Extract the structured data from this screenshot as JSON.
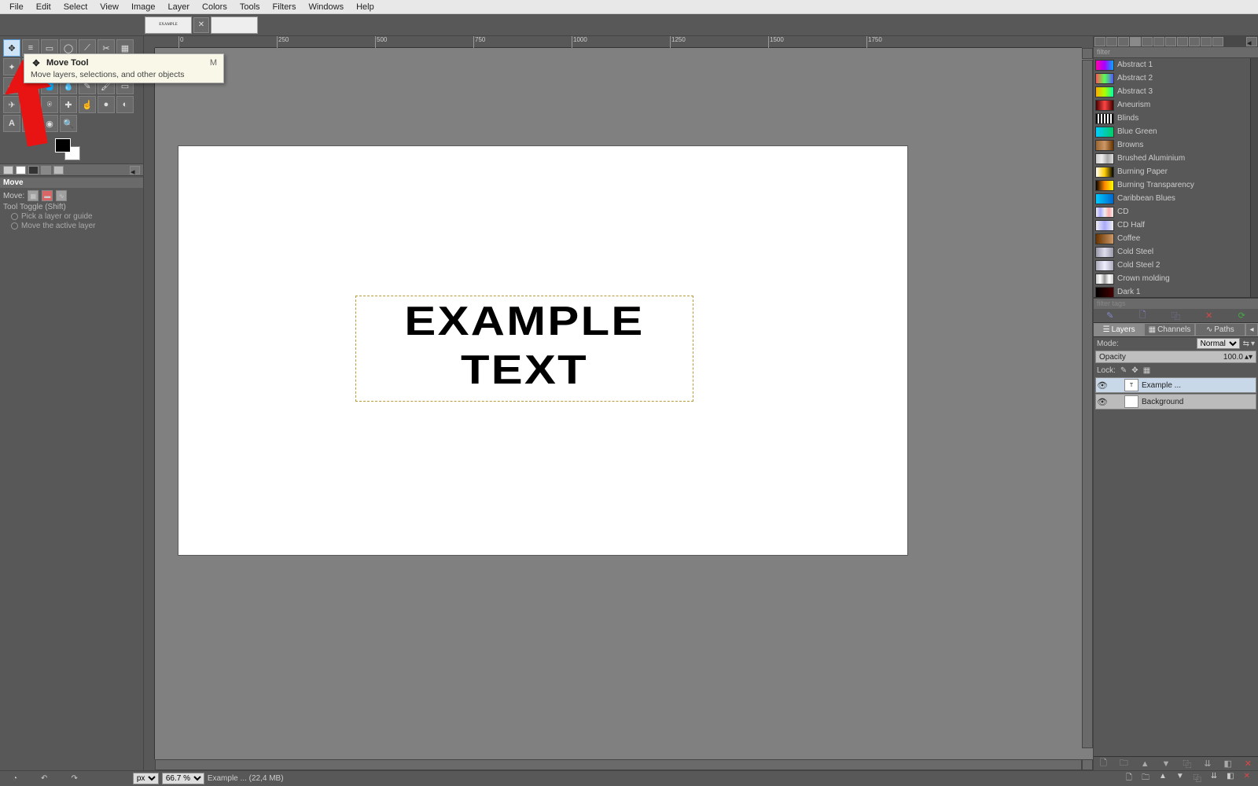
{
  "menubar": [
    "File",
    "Edit",
    "Select",
    "View",
    "Image",
    "Layer",
    "Colors",
    "Tools",
    "Filters",
    "Windows",
    "Help"
  ],
  "tooltip": {
    "title": "Move Tool",
    "shortcut": "M",
    "desc": "Move layers, selections, and other objects"
  },
  "tool_options": {
    "title": "Move",
    "move_label": "Move:",
    "toggle_label": "Tool Toggle  (Shift)",
    "radio1": "Pick a layer or guide",
    "radio2": "Move the active layer"
  },
  "ruler_ticks": [
    "0",
    "250",
    "500",
    "750",
    "1000",
    "1250",
    "1500",
    "1750"
  ],
  "canvas_text": {
    "line1": "EXAMPLE",
    "line2": "TEXT"
  },
  "gradients": [
    {
      "name": "Abstract 1",
      "css": "linear-gradient(90deg,#f0a,#a0f,#0af)"
    },
    {
      "name": "Abstract 2",
      "css": "linear-gradient(90deg,#f55,#5f5,#55f)"
    },
    {
      "name": "Abstract 3",
      "css": "linear-gradient(90deg,#fa0,#af0,#0fa)"
    },
    {
      "name": "Aneurism",
      "css": "linear-gradient(90deg,#400,#f44,#400)"
    },
    {
      "name": "Blinds",
      "css": "repeating-linear-gradient(90deg,#000 0 2px,#fff 2px 4px)"
    },
    {
      "name": "Blue Green",
      "css": "linear-gradient(90deg,#0cf,#0c6)"
    },
    {
      "name": "Browns",
      "css": "linear-gradient(90deg,#963,#c96,#630)"
    },
    {
      "name": "Brushed Aluminium",
      "css": "linear-gradient(90deg,#ccc,#eee,#aaa,#ddd)"
    },
    {
      "name": "Burning Paper",
      "css": "linear-gradient(90deg,#fff,#fc0,#000)"
    },
    {
      "name": "Burning Transparency",
      "css": "linear-gradient(90deg,#000,#f80,#ff0)"
    },
    {
      "name": "Caribbean Blues",
      "css": "linear-gradient(90deg,#0cf,#06c)"
    },
    {
      "name": "CD",
      "css": "linear-gradient(90deg,#eee,#aaf,#eee,#faa,#eee)"
    },
    {
      "name": "CD Half",
      "css": "linear-gradient(90deg,#eee,#aaf,#eee)"
    },
    {
      "name": "Coffee",
      "css": "linear-gradient(90deg,#630,#c96)"
    },
    {
      "name": "Cold Steel",
      "css": "linear-gradient(90deg,#99a,#dde,#99a)"
    },
    {
      "name": "Cold Steel 2",
      "css": "linear-gradient(90deg,#aab,#eef,#aab)"
    },
    {
      "name": "Crown molding",
      "css": "linear-gradient(90deg,#ccc,#fff,#999,#fff,#ccc)"
    },
    {
      "name": "Dark 1",
      "css": "linear-gradient(90deg,#000,#400)"
    }
  ],
  "tag_placeholder": "filter tags",
  "panel_tabs": {
    "layers": "Layers",
    "channels": "Channels",
    "paths": "Paths"
  },
  "layer_panel": {
    "mode_label": "Mode:",
    "mode_value": "Normal",
    "opacity_label": "Opacity",
    "opacity_value": "100.0",
    "lock_label": "Lock:"
  },
  "layers": [
    {
      "name": "Example ...",
      "thumb": "T",
      "sel": true
    },
    {
      "name": "Background",
      "thumb": "",
      "sel": false
    }
  ],
  "statusbar": {
    "unit": "px",
    "zoom": "66.7 %",
    "title": "Example ... (22,4 MB)"
  },
  "filter_label": "filter"
}
